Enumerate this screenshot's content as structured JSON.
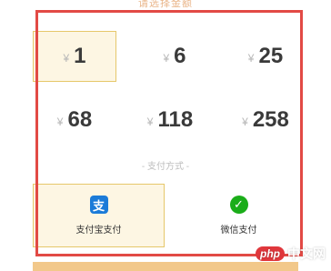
{
  "caption": "请选择金额",
  "currency_symbol": "¥",
  "amounts": [
    {
      "value": "1",
      "selected": true
    },
    {
      "value": "6",
      "selected": false
    },
    {
      "value": "25",
      "selected": false
    },
    {
      "value": "68",
      "selected": false
    },
    {
      "value": "118",
      "selected": false
    },
    {
      "value": "258",
      "selected": false
    }
  ],
  "payment_section_label": "- 支付方式 -",
  "payment_methods": [
    {
      "label": "支付宝支付",
      "icon": "alipay-icon",
      "glyph": "支",
      "selected": true
    },
    {
      "label": "微信支付",
      "icon": "wechat-icon",
      "glyph": "✓",
      "selected": false
    }
  ],
  "watermark": {
    "logo": "php",
    "text": "中文网"
  },
  "colors": {
    "selected_bg": "#fdf6e3",
    "selected_border": "#e6c76a",
    "annotation_frame": "#e24a45",
    "alipay_blue": "#1c7bd8",
    "wechat_green": "#1aad19"
  }
}
